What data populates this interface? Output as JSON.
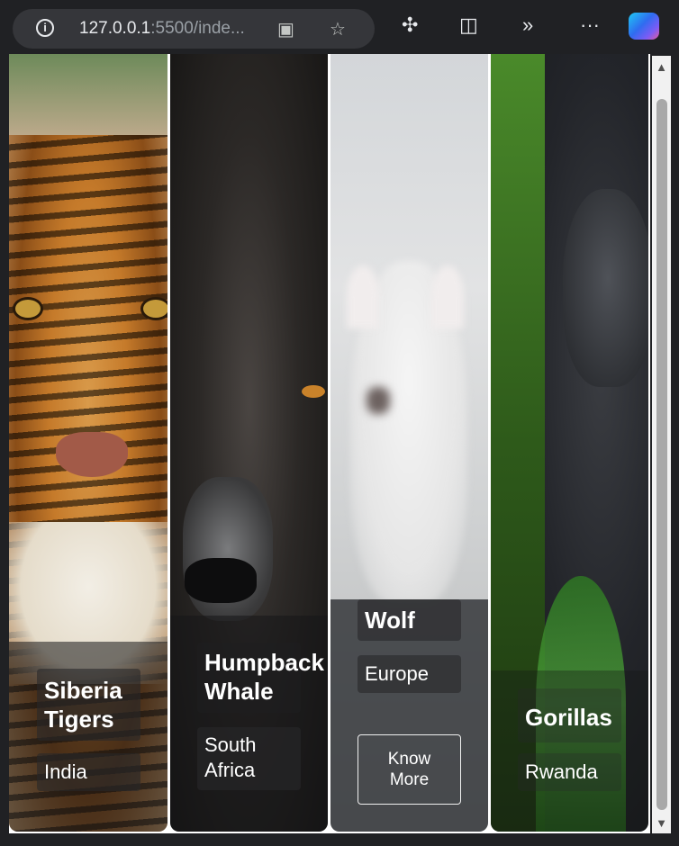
{
  "browser": {
    "url_host": "127.0.0.1",
    "url_rest": ":5500/inde..."
  },
  "animals": [
    {
      "name_line1": "Siberia",
      "name_line2": "Tigers",
      "location_line1": "India",
      "location_line2": ""
    },
    {
      "name_line1": "Humpback",
      "name_line2": "Whale",
      "location_line1": "South",
      "location_line2": "Africa"
    },
    {
      "name_line1": "Wolf",
      "name_line2": "",
      "location_line1": "Europe",
      "location_line2": "",
      "button_line1": "Know",
      "button_line2": "More"
    },
    {
      "name_line1": "Gorillas",
      "name_line2": "",
      "location_line1": "Rwanda",
      "location_line2": ""
    }
  ]
}
